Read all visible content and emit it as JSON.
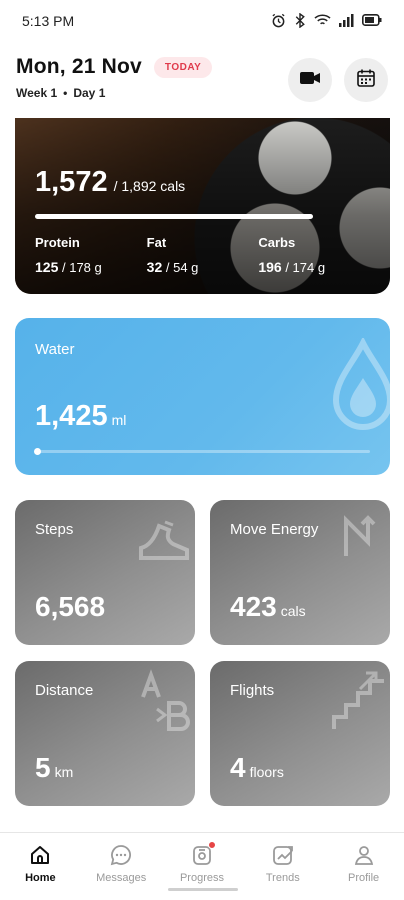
{
  "status_bar": {
    "time": "5:13 PM",
    "icons": [
      "alarm-icon",
      "bluetooth-icon",
      "wifi-icon",
      "signal-icon",
      "battery-icon"
    ]
  },
  "header": {
    "date": "Mon, 21 Nov",
    "badge": "TODAY",
    "week": "Week 1",
    "separator": "•",
    "day": "Day 1",
    "actions": [
      "video-icon",
      "calendar-icon"
    ]
  },
  "calories": {
    "consumed": "1,572",
    "target": "/ 1,892 cals",
    "progress": 0.83,
    "macros": [
      {
        "label": "Protein",
        "value": "125",
        "target": "/ 178 g"
      },
      {
        "label": "Fat",
        "value": "32",
        "target": "/ 54 g"
      },
      {
        "label": "Carbs",
        "value": "196",
        "target": "/ 174 g"
      }
    ]
  },
  "water": {
    "label": "Water",
    "value": "1,425",
    "unit": "ml"
  },
  "stats": {
    "steps": {
      "label": "Steps",
      "value": "6,568",
      "unit": ""
    },
    "move_energy": {
      "label": "Move Energy",
      "value": "423",
      "unit": "cals"
    },
    "distance": {
      "label": "Distance",
      "value": "5",
      "unit": "km"
    },
    "flights": {
      "label": "Flights",
      "value": "4",
      "unit": "floors"
    }
  },
  "nav": {
    "items": [
      {
        "label": "Home",
        "icon": "home-icon"
      },
      {
        "label": "Messages",
        "icon": "chat-icon"
      },
      {
        "label": "Progress",
        "icon": "progress-icon"
      },
      {
        "label": "Trends",
        "icon": "trends-icon"
      },
      {
        "label": "Profile",
        "icon": "person-icon"
      }
    ]
  },
  "colors": {
    "accent_red": "#e03a4b",
    "water_blue": "#56b2ea",
    "stat_gray": "#8f8f8f"
  }
}
